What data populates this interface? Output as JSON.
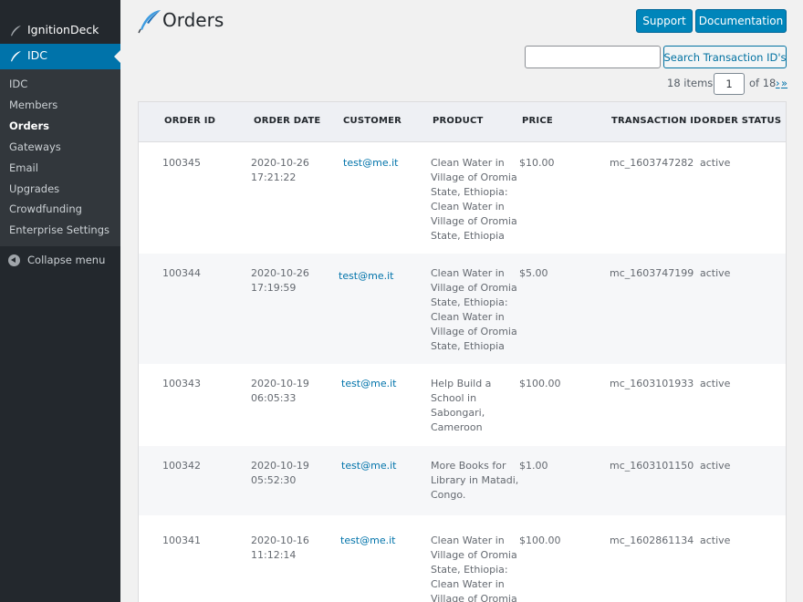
{
  "sidebar": {
    "top_item": {
      "label": "IgnitionDeck",
      "icon": "feather-icon"
    },
    "active_item": {
      "label": "IDC",
      "icon": "feather-icon"
    },
    "submenu": [
      {
        "label": "IDC"
      },
      {
        "label": "Members"
      },
      {
        "label": "Orders"
      },
      {
        "label": "Gateways"
      },
      {
        "label": "Email"
      },
      {
        "label": "Upgrades"
      },
      {
        "label": "Crowdfunding"
      },
      {
        "label": "Enterprise Settings"
      }
    ],
    "current_submenu": "Orders",
    "collapse_label": "Collapse menu"
  },
  "header": {
    "title": "Orders",
    "support_label": "Support",
    "documentation_label": "Documentation"
  },
  "search": {
    "value": "",
    "placeholder": "",
    "button_label": "Search Transaction ID's"
  },
  "pagination": {
    "items_text": "18 items",
    "current_page": "1",
    "of_text": "of 18",
    "next": "›",
    "last": "»"
  },
  "table": {
    "columns": [
      "ORDER ID",
      "ORDER DATE",
      "CUSTOMER",
      "PRODUCT",
      "PRICE",
      "TRANSACTION ID",
      "ORDER STATUS"
    ],
    "rows": [
      {
        "order_id": "100345",
        "date": [
          "2020-10-26",
          "17:21:22"
        ],
        "customer": "test@me.it",
        "product": [
          "Clean Water in",
          "Village of Oromia",
          "State, Ethiopia:",
          "Clean Water in",
          "Village of Oromia",
          "State, Ethiopia"
        ],
        "price": "$10.00",
        "transaction_id": "mc_1603747282",
        "status": "active"
      },
      {
        "order_id": "100344",
        "date": [
          "2020-10-26",
          "17:19:59"
        ],
        "customer": "test@me.it",
        "product": [
          "Clean Water in",
          "Village of Oromia",
          "State, Ethiopia:",
          "Clean Water in",
          "Village of Oromia",
          "State, Ethiopia"
        ],
        "price": "$5.00",
        "transaction_id": "mc_1603747199",
        "status": "active"
      },
      {
        "order_id": "100343",
        "date": [
          "2020-10-19",
          "06:05:33"
        ],
        "customer": "test@me.it",
        "product": [
          "Help Build a",
          "School in",
          "Sabongari,",
          "Cameroon"
        ],
        "price": "$100.00",
        "transaction_id": "mc_1603101933",
        "status": "active"
      },
      {
        "order_id": "100342",
        "date": [
          "2020-10-19",
          "05:52:30"
        ],
        "customer": "test@me.it",
        "product": [
          "More Books for",
          "Library in Matadi,",
          "Congo."
        ],
        "price": "$1.00",
        "transaction_id": "mc_1603101150",
        "status": "active"
      },
      {
        "order_id": "100341",
        "date": [
          "2020-10-16",
          "11:12:14"
        ],
        "customer": "test@me.it",
        "product": [
          "Clean Water in",
          "Village of Oromia",
          "State, Ethiopia:",
          "Clean Water in",
          "Village of Oromia"
        ],
        "price": "$100.00",
        "transaction_id": "mc_1602861134",
        "status": "active"
      }
    ]
  },
  "colors": {
    "sidebar_bg": "#23282d",
    "submenu_bg": "#32373c",
    "accent": "#0073aa",
    "button_blue": "#0085ba"
  }
}
